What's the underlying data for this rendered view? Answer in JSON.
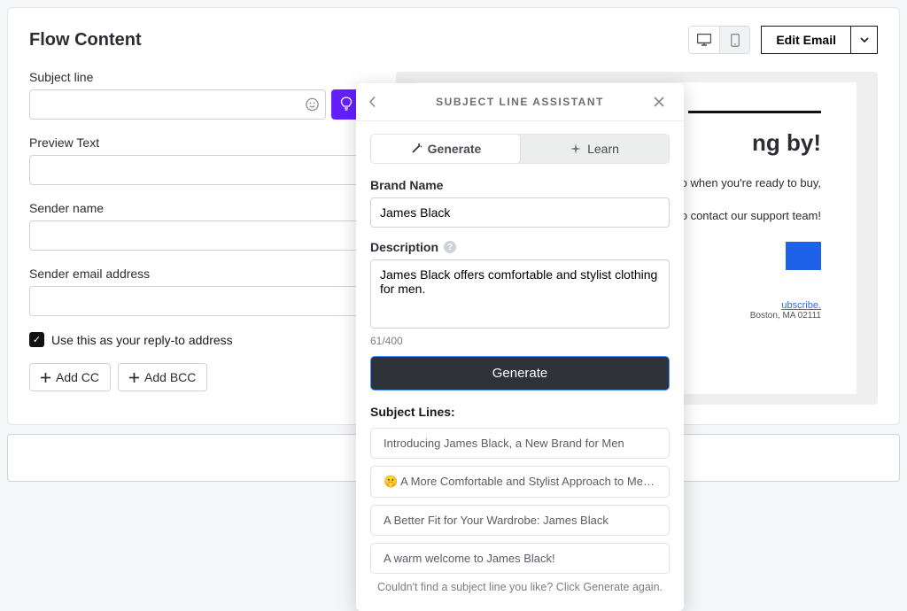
{
  "header": {
    "title": "Flow Content",
    "edit_email": "Edit Email"
  },
  "form": {
    "subject_label": "Subject line",
    "subject_value": "",
    "preview_label": "Preview Text",
    "preview_value": "",
    "sender_name_label": "Sender name",
    "sender_name_value": "",
    "sender_email_label": "Sender email address",
    "sender_email_value": "",
    "reply_to_label": "Use this as your reply-to address",
    "add_cc": "Add CC",
    "add_bcc": "Add BCC"
  },
  "preview": {
    "headline": "ng by!",
    "line1": "o when you're ready to buy,",
    "line2": "o contact our support team!",
    "unsub": "ubscribe.",
    "addr": "Boston, MA 02111"
  },
  "popover": {
    "title": "SUBJECT LINE ASSISTANT",
    "tab_generate": "Generate",
    "tab_learn": "Learn",
    "brand_label": "Brand Name",
    "brand_value": "James Black",
    "desc_label": "Description",
    "desc_value": "James Black offers comfortable and stylist clothing for men.",
    "char_count": "61/400",
    "generate_btn": "Generate",
    "results_label": "Subject Lines:",
    "suggestions": [
      "Introducing James Black, a New Brand for Men",
      "🤫 A More Comfortable and Stylist Approach to Men's Clothing...",
      "A Better Fit for Your Wardrobe: James Black",
      "A warm welcome to James Black!"
    ],
    "footer": "Couldn't find a subject line you like? Click Generate again."
  }
}
